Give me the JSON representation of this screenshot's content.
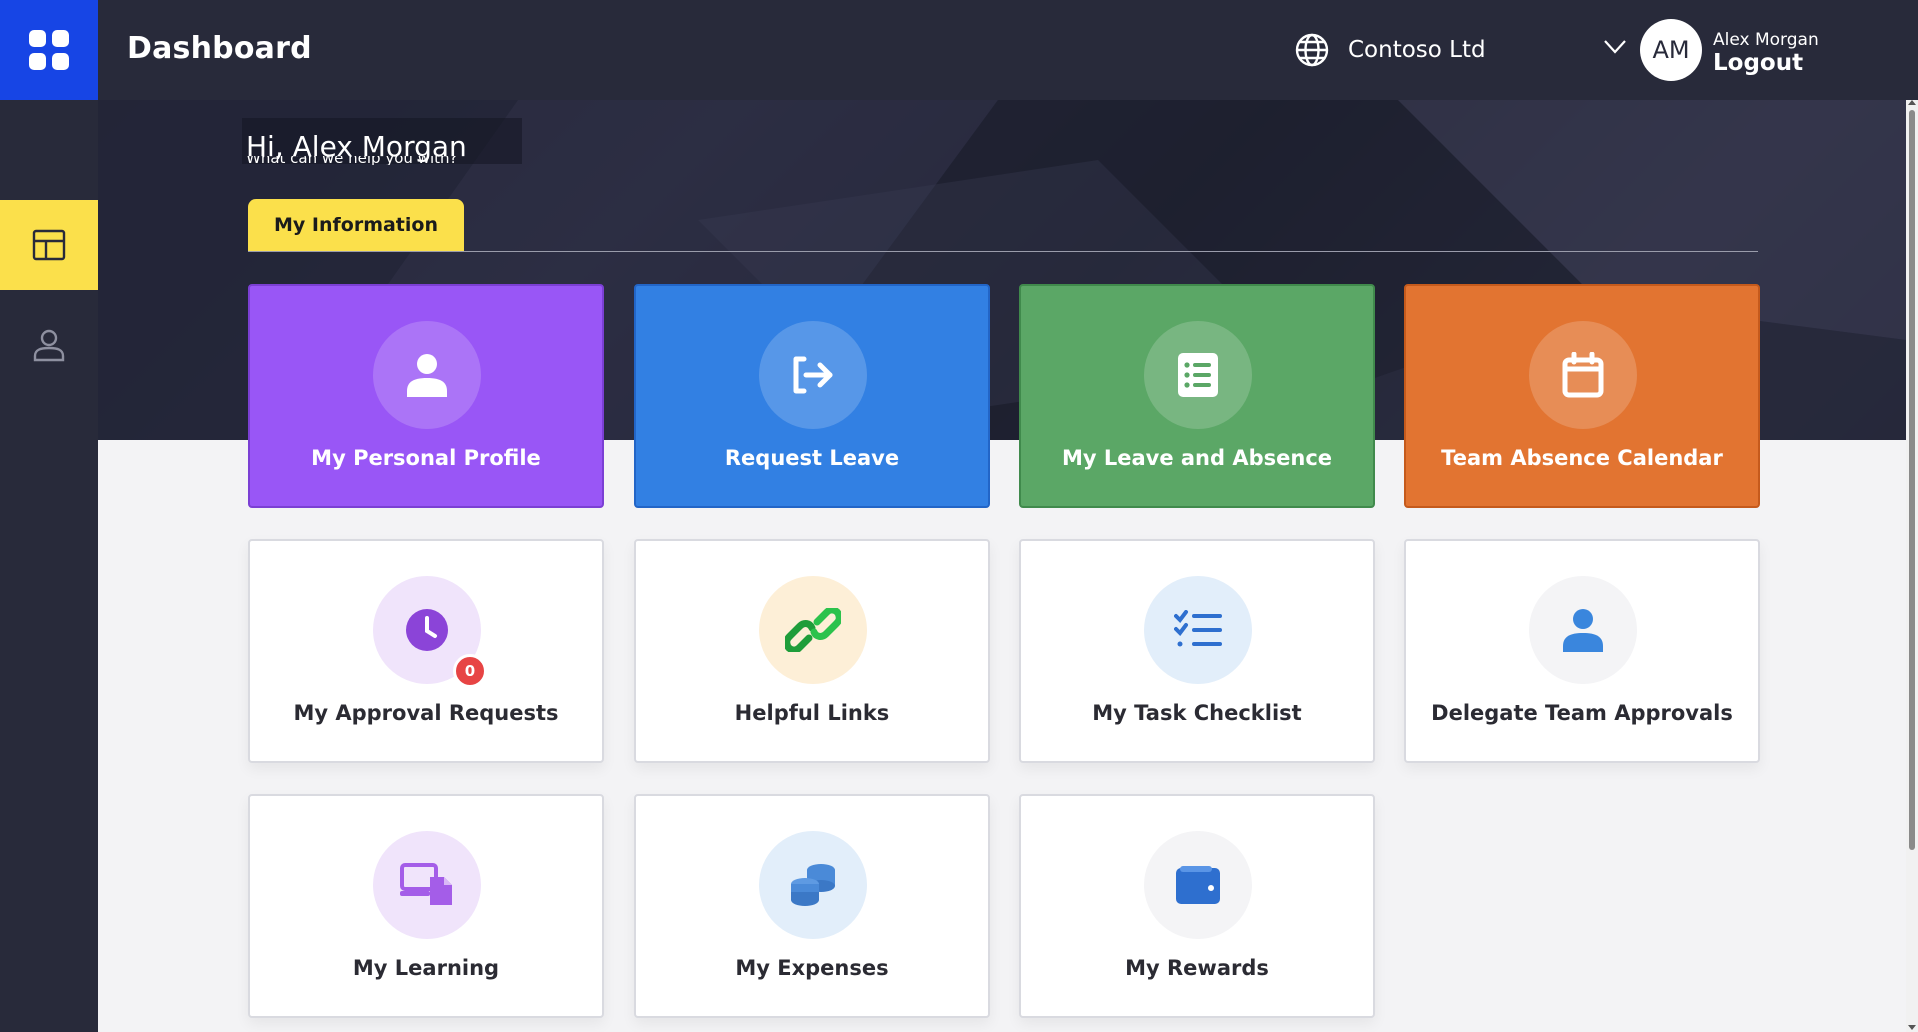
{
  "header": {
    "title": "Dashboard",
    "organization": "Contoso Ltd",
    "user_initials": "AM",
    "user_name": "Alex Morgan",
    "logout_label": "Logout"
  },
  "hero": {
    "greeting": "Hi, Alex Morgan",
    "subtitle": "What can we help you with?",
    "tab_label": "My Information"
  },
  "tiles": [
    {
      "label": "My Personal Profile",
      "icon": "user-icon",
      "style": "purple"
    },
    {
      "label": "Request Leave",
      "icon": "sign-out-icon",
      "style": "blue"
    },
    {
      "label": "My Leave and Absence",
      "icon": "checklist-icon",
      "style": "green"
    },
    {
      "label": "Team Absence Calendar",
      "icon": "calendar-icon",
      "style": "orange"
    },
    {
      "label": "My Approval Requests",
      "icon": "clock-icon",
      "badge": "0"
    },
    {
      "label": "Helpful Links",
      "icon": "link-icon"
    },
    {
      "label": "My Task Checklist",
      "icon": "task-list-icon"
    },
    {
      "label": "Delegate Team Approvals",
      "icon": "user-icon"
    },
    {
      "label": "My Learning",
      "icon": "devices-icon"
    },
    {
      "label": "My Expenses",
      "icon": "coins-icon"
    },
    {
      "label": "My Rewards",
      "icon": "wallet-icon"
    }
  ],
  "colors": {
    "brand_blue": "#1745e5",
    "accent_yellow": "#fbe04b",
    "topbar": "#282a3a",
    "badge_red": "#e74444"
  }
}
